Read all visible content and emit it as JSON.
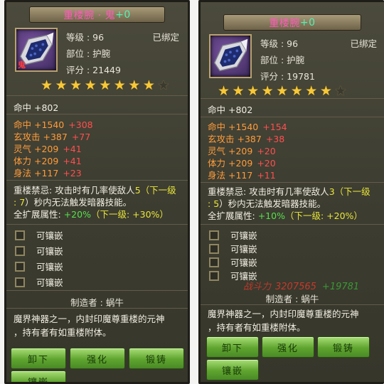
{
  "left": {
    "title_name": "重楼腕 · 鬼",
    "title_plus": "+0",
    "icon_tag": "鬼",
    "level": "等级 : 96",
    "slot": "部位 : 护腕",
    "score": "评分 : 21449",
    "bound": "已绑定",
    "stars_filled": 8,
    "stars_total": 9,
    "base_stat": "命中 +802",
    "stats": [
      {
        "text": "命中 +1540",
        "bonus": "+308"
      },
      {
        "text": "玄攻击 +387",
        "bonus": "+77"
      },
      {
        "text": "灵气 +209",
        "bonus": "+41"
      },
      {
        "text": "体力 +209",
        "bonus": "+41"
      },
      {
        "text": "身法 +117",
        "bonus": "+23"
      }
    ],
    "skill_a": "重楼禁忌: 攻击时有几率使敌人",
    "skill_a_num": "5",
    "skill_a_next": "（下一级",
    "skill_b_pre": ": ",
    "skill_b_num": "7",
    "skill_b_rest": "）秒内无法触发暗器技能。",
    "expand_label": "全扩展属性: ",
    "expand_value": "+20%",
    "expand_next": "（下一级: +30%）",
    "sockets": [
      "可镶嵌",
      "可镶嵌",
      "可镶嵌",
      "可镶嵌"
    ],
    "maker": "制造者 : 蜗牛",
    "flavor_1": "魔界神器之一，内封印魔尊重楼的元神",
    "flavor_2": "，持有者有如重楼附体。",
    "buttons": [
      "卸下",
      "强化",
      "锻铸",
      "镶嵌"
    ]
  },
  "right": {
    "title_name": "重楼腕",
    "title_plus": "+0",
    "level": "等级 : 96",
    "slot": "部位 : 护腕",
    "score": "评分 : 19781",
    "bound": "已绑定",
    "stars_filled": 8,
    "stars_total": 9,
    "base_stat": "命中 +802",
    "stats": [
      {
        "text": "命中 +1540",
        "bonus": "+154"
      },
      {
        "text": "玄攻击 +387",
        "bonus": "+38"
      },
      {
        "text": "灵气 +209",
        "bonus": "+20"
      },
      {
        "text": "体力 +209",
        "bonus": "+20"
      },
      {
        "text": "身法 +117",
        "bonus": "+11"
      }
    ],
    "skill_a": "重楼禁忌: 攻击时有几率使敌人",
    "skill_a_num": "3",
    "skill_a_next": "（下一级",
    "skill_b_pre": ": ",
    "skill_b_num": "5",
    "skill_b_rest": "）秒内无法触发暗器技能。",
    "expand_label": "全扩展属性: ",
    "expand_value": "+10%",
    "expand_next": "（下一级: +20%）",
    "sockets": [
      "可镶嵌",
      "可镶嵌",
      "可镶嵌",
      "可镶嵌"
    ],
    "power_label": "战斗力",
    "power_value": "3207565",
    "power_gain": "+19781",
    "maker": "制造者 : 蜗牛",
    "flavor_1": "魔界神器之一，内封印魔尊重楼的元神",
    "flavor_2": "，持有者有如重楼附体。",
    "buttons": [
      "卸下",
      "强化",
      "锻铸",
      "镶嵌"
    ]
  },
  "colors": {
    "title_pink": "#ff5ab9",
    "plus_green": "#55f0b2",
    "stat_orange": "#ff9c3a",
    "bonus_red": "#ff4f4f",
    "highlight_yellow": "#e9e63a",
    "highlight_green": "#56e04c",
    "star_gold": "#f7c838",
    "button_green": "#5fa42f"
  },
  "icons": {
    "item": "wrist-guard-icon",
    "star": "star-icon",
    "socket": "checkbox-icon"
  }
}
